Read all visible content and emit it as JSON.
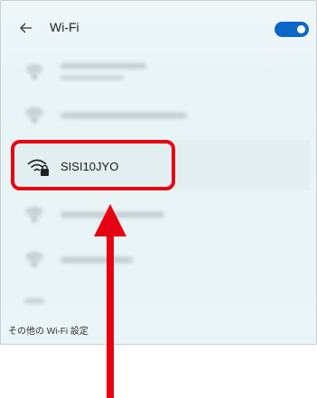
{
  "header": {
    "title": "Wi-Fi",
    "back_icon": "arrow-left-icon",
    "toggle_state": "on",
    "toggle_color": "#0a67c8"
  },
  "networks": [
    {
      "ssid": "",
      "obscured": true
    },
    {
      "ssid": "",
      "obscured": true
    },
    {
      "ssid": "SISI10JYO",
      "obscured": false,
      "secured": true,
      "icon": "wifi-lock-icon"
    },
    {
      "ssid": "",
      "obscured": true
    },
    {
      "ssid": "",
      "obscured": true
    }
  ],
  "footer": {
    "link_text": "その他の Wi-Fi 設定"
  },
  "annotation": {
    "highlight_color": "#e60012",
    "arrow_color": "#e60012"
  }
}
